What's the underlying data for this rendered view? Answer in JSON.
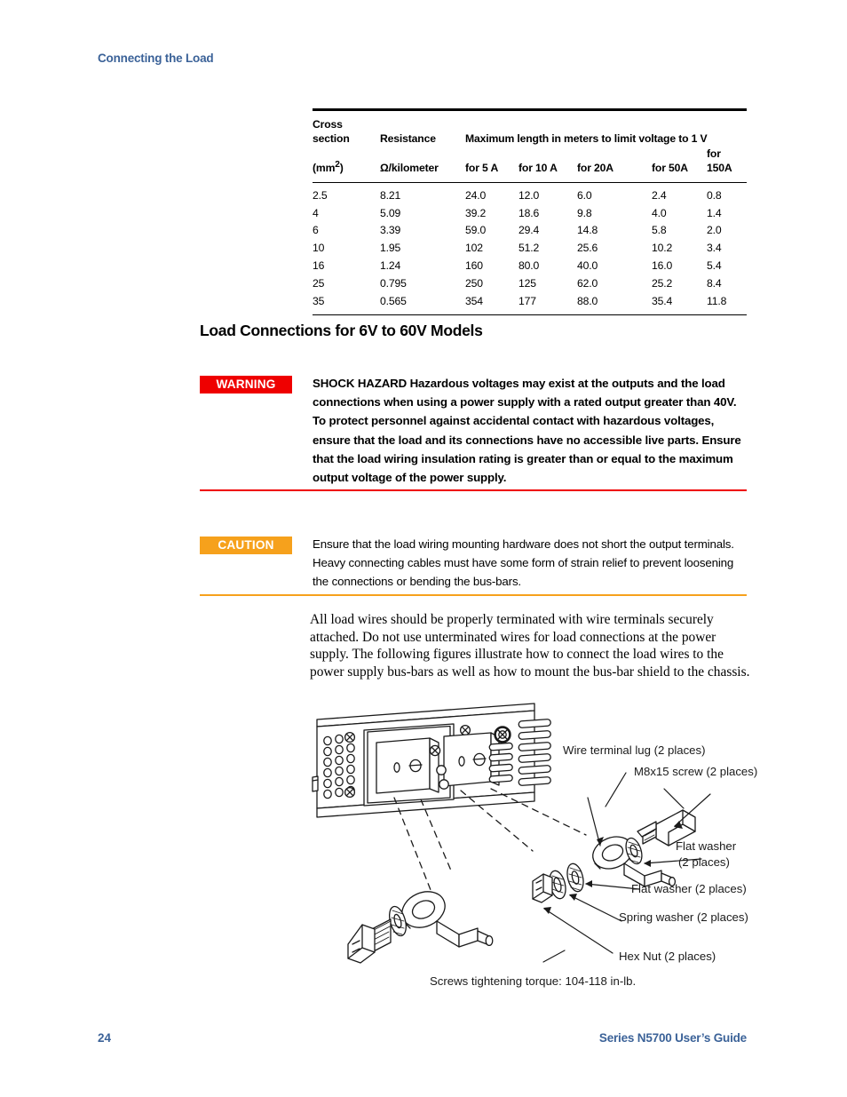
{
  "header": {
    "running_head": "Connecting the Load"
  },
  "table": {
    "headers": {
      "col1_line1": "Cross",
      "col1_line2": "section",
      "col1_line3": "(mm2)",
      "col1_line3_base": "(mm",
      "col1_line3_sup": "2",
      "col1_line3_tail": ")",
      "col2_line2": "Resistance",
      "col2_line3": "Ω/kilometer",
      "span_header": "Maximum length in meters to limit voltage to 1 V",
      "sub_5a": "for 5 A",
      "sub_10a": "for 10 A",
      "sub_20a": "for 20A",
      "sub_50a": "for 50A",
      "sub_150a": "for 150A"
    },
    "rows": [
      [
        "2.5",
        "8.21",
        "24.0",
        "12.0",
        "6.0",
        "2.4",
        "0.8"
      ],
      [
        "4",
        "5.09",
        "39.2",
        "18.6",
        "9.8",
        "4.0",
        "1.4"
      ],
      [
        "6",
        "3.39",
        "59.0",
        "29.4",
        "14.8",
        "5.8",
        "2.0"
      ],
      [
        "10",
        "1.95",
        "102",
        "51.2",
        "25.6",
        "10.2",
        "3.4"
      ],
      [
        "16",
        "1.24",
        "160",
        "80.0",
        "40.0",
        "16.0",
        "5.4"
      ],
      [
        "25",
        "0.795",
        "250",
        "125",
        "62.0",
        "25.2",
        "8.4"
      ],
      [
        "35",
        "0.565",
        "354",
        "177",
        "88.0",
        "35.4",
        "11.8"
      ]
    ]
  },
  "section": {
    "title": "Load Connections for 6V to 60V Models"
  },
  "warning": {
    "badge": "WARNING",
    "text": "SHOCK HAZARD  Hazardous voltages may exist at the outputs and the load connections when using a power supply with a rated output greater than 40V. To protect personnel against accidental contact with hazardous voltages, ensure that the load and its connections have no accessible live parts. Ensure that the load wiring insulation rating is greater than or equal to the maximum output voltage of the power supply.",
    "rule_color": "#ef0000",
    "badge_color": "#ef0000"
  },
  "caution": {
    "badge": "CAUTION",
    "text": "Ensure that the load wiring mounting hardware does not short the output terminals. Heavy connecting cables must have some form of strain relief to prevent loosening the connections or bending the bus-bars.",
    "rule_color": "#f6a11c",
    "badge_color": "#f6a11c"
  },
  "body": {
    "paragraph": "All load wires should be properly terminated with wire terminals securely attached. Do not use unterminated wires for load connections at the power supply. The following figures illustrate how to connect the load wires to the power supply bus-bars as well as how to mount the bus-bar shield to the chassis."
  },
  "figure": {
    "callouts": {
      "wire_terminal_lug": "Wire terminal lug (2 places)",
      "m8x15_screw": "M8x15 screw (2 places)",
      "flat_washer_upper_l1": "Flat washer",
      "flat_washer_upper_l2": "(2 places)",
      "flat_washer_mid": "Flat washer (2 places)",
      "spring_washer": "Spring washer (2 places)",
      "hex_nut": "Hex Nut (2 places)"
    },
    "torque_note": "Screws tightening torque: 104-118 in-lb."
  },
  "footer": {
    "page_number": "24",
    "guide_title": "Series N5700 User’s Guide",
    "color": "#3b6298"
  }
}
